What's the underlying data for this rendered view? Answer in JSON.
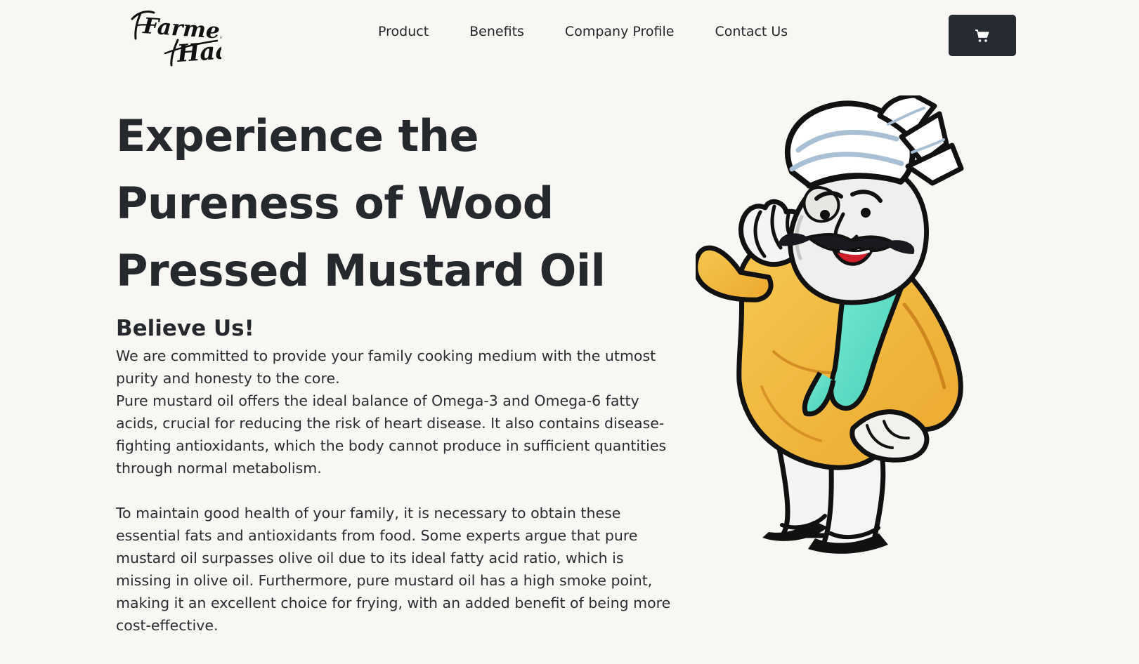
{
  "brand": {
    "name": "Farmers Haat",
    "logo_line_1": "Farmers",
    "logo_line_2": "Haat"
  },
  "nav": {
    "items": [
      {
        "label": "Product"
      },
      {
        "label": "Benefits"
      },
      {
        "label": "Company Profile"
      },
      {
        "label": "Contact Us"
      }
    ]
  },
  "cart": {
    "icon": "shopping-cart-icon"
  },
  "hero": {
    "title_line_1": "Experience the",
    "title_line_2": "Pureness of Wood",
    "title_line_3": "Pressed Mustard Oil",
    "subtitle": "Believe Us!",
    "paragraph_1": "We are committed to provide your family cooking medium with the utmost purity and honesty to the core.",
    "paragraph_2": "Pure mustard oil offers the ideal balance of Omega-3 and Omega-6 fatty acids, crucial for reducing the risk of heart disease. It also contains disease-fighting antioxidants, which the body cannot produce in sufficient quantities through normal metabolism.",
    "paragraph_3": "To maintain good health of your family, it is necessary to obtain these essential fats and antioxidants from food. Some experts argue that pure mustard oil surpasses olive oil due to its ideal fatty acid ratio, which is missing in olive oil. Furthermore, pure mustard oil has a high smoke point, making it an excellent choice for frying, with an added benefit of being more cost-effective."
  },
  "illustration": {
    "subject": "farmer mascot with turban and green scarf",
    "colors": {
      "kurta": "#f3b83e",
      "scarf": "#62dfc8",
      "turban": "#ffffff",
      "outline": "#111111"
    }
  }
}
